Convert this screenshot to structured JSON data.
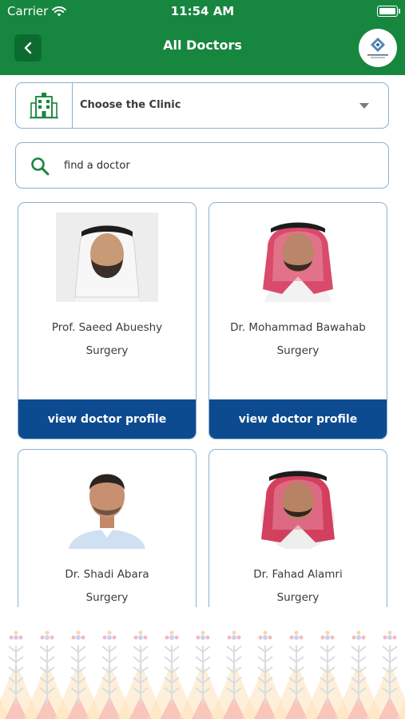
{
  "status_bar": {
    "carrier": "Carrier",
    "time": "11:54 AM"
  },
  "header": {
    "title": "All Doctors"
  },
  "clinic_select": {
    "label": "Choose the Clinic"
  },
  "search": {
    "placeholder": "find a doctor"
  },
  "doctors": [
    {
      "name": "Prof. Saeed Abueshy",
      "specialty": "Surgery",
      "button": "view doctor profile"
    },
    {
      "name": "Dr. Mohammad Bawahab",
      "specialty": "Surgery",
      "button": "view doctor profile"
    },
    {
      "name": "Dr. Shadi Abara",
      "specialty": "Surgery"
    },
    {
      "name": "Dr. Fahad Alamri",
      "specialty": "Surgery"
    }
  ],
  "colors": {
    "header_green": "#17863f",
    "button_blue": "#0d4b90",
    "border": "#8fb0cc"
  },
  "icons": [
    "wifi-icon",
    "battery-icon",
    "back-chevron-icon",
    "hospital-building-icon",
    "dropdown-caret-icon",
    "search-icon"
  ]
}
